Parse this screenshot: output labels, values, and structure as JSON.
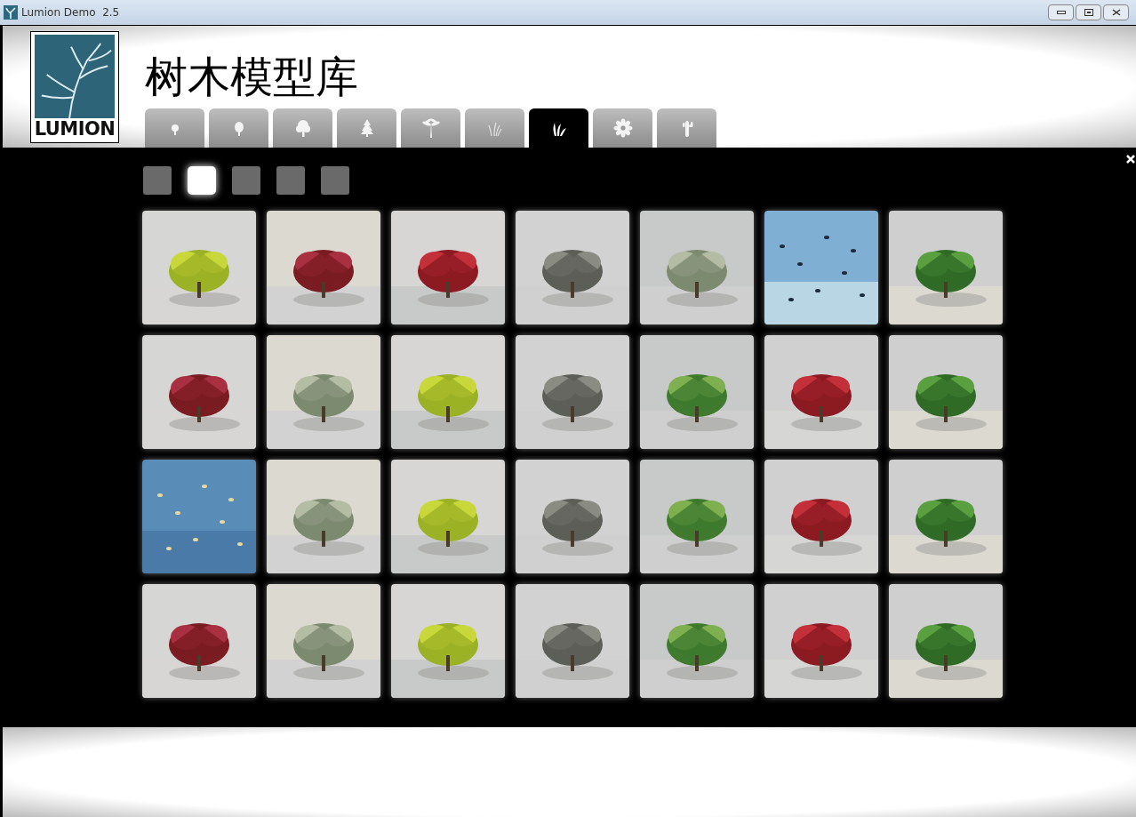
{
  "window": {
    "title": "Lumion Demo  2.5"
  },
  "logo": {
    "text": "LUMION"
  },
  "heading": "树木模型库",
  "tabs": [
    {
      "kind": "small-tree",
      "selected": false
    },
    {
      "kind": "tree",
      "selected": false
    },
    {
      "kind": "big-tree",
      "selected": false
    },
    {
      "kind": "pine",
      "selected": false
    },
    {
      "kind": "palm",
      "selected": false
    },
    {
      "kind": "grass",
      "selected": false
    },
    {
      "kind": "plant",
      "selected": true
    },
    {
      "kind": "flower",
      "selected": false
    },
    {
      "kind": "cactus",
      "selected": false
    }
  ],
  "pages": [
    {
      "selected": false
    },
    {
      "selected": true
    },
    {
      "selected": false
    },
    {
      "selected": false
    },
    {
      "selected": false
    }
  ]
}
